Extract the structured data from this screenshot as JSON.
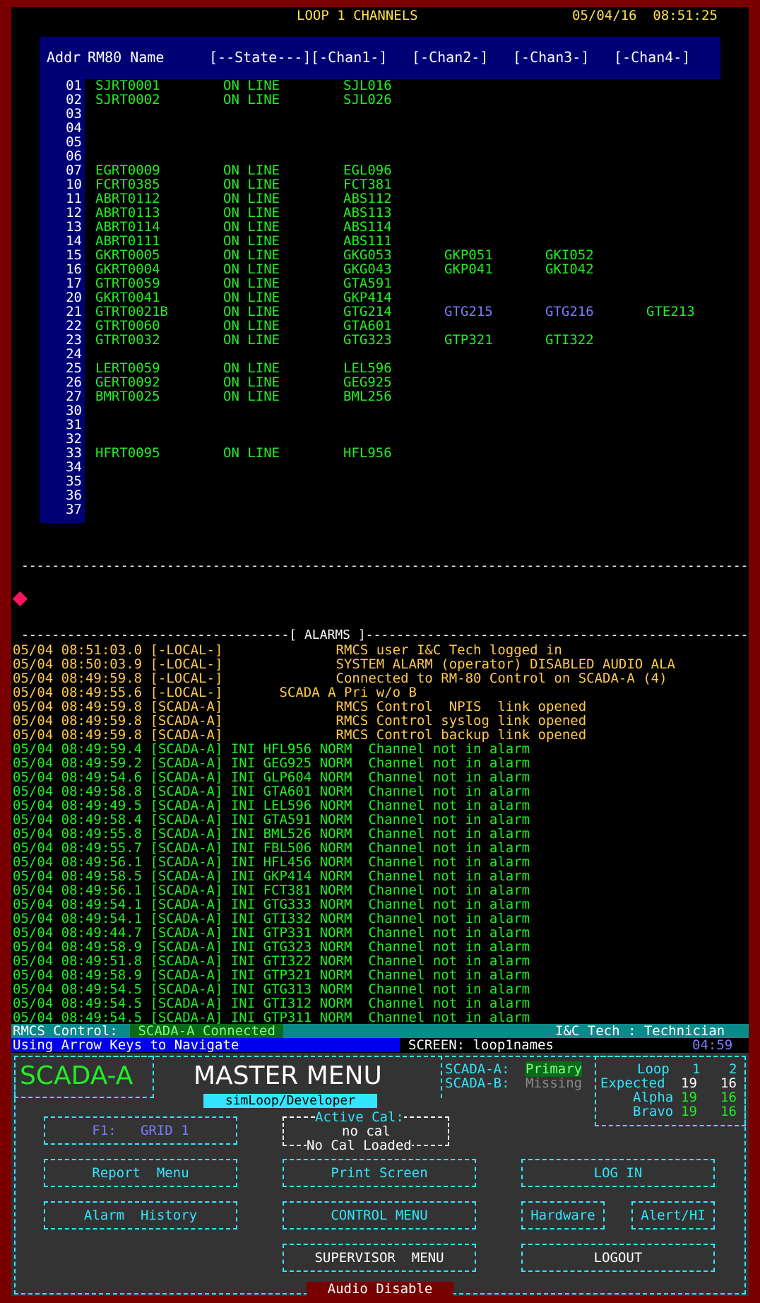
{
  "header": {
    "title": "LOOP 1 CHANNELS",
    "datetime": "05/04/16  08:51:25"
  },
  "table": {
    "headers": [
      "Addr",
      "RM80 Name",
      "[--State---]",
      "[-Chan1-]",
      "[-Chan2-]",
      "[-Chan3-]",
      "[-Chan4-]"
    ],
    "rows": [
      {
        "addr": "01",
        "name": "SJRT0001",
        "state": "ON LINE",
        "c1": "SJL016",
        "c2": "",
        "c3": "",
        "c4": ""
      },
      {
        "addr": "02",
        "name": "SJRT0002",
        "state": "ON LINE",
        "c1": "SJL026",
        "c2": "",
        "c3": "",
        "c4": ""
      },
      {
        "addr": "03",
        "name": "",
        "state": "",
        "c1": "",
        "c2": "",
        "c3": "",
        "c4": ""
      },
      {
        "addr": "04",
        "name": "",
        "state": "",
        "c1": "",
        "c2": "",
        "c3": "",
        "c4": ""
      },
      {
        "addr": "05",
        "name": "",
        "state": "",
        "c1": "",
        "c2": "",
        "c3": "",
        "c4": ""
      },
      {
        "addr": "06",
        "name": "",
        "state": "",
        "c1": "",
        "c2": "",
        "c3": "",
        "c4": ""
      },
      {
        "addr": "07",
        "name": "EGRT0009",
        "state": "ON LINE",
        "c1": "EGL096",
        "c2": "",
        "c3": "",
        "c4": ""
      },
      {
        "addr": "10",
        "name": "FCRT0385",
        "state": "ON LINE",
        "c1": "FCT381",
        "c2": "",
        "c3": "",
        "c4": ""
      },
      {
        "addr": "11",
        "name": "ABRT0112",
        "state": "ON LINE",
        "c1": "ABS112",
        "c2": "",
        "c3": "",
        "c4": ""
      },
      {
        "addr": "12",
        "name": "ABRT0113",
        "state": "ON LINE",
        "c1": "ABS113",
        "c2": "",
        "c3": "",
        "c4": ""
      },
      {
        "addr": "13",
        "name": "ABRT0114",
        "state": "ON LINE",
        "c1": "ABS114",
        "c2": "",
        "c3": "",
        "c4": ""
      },
      {
        "addr": "14",
        "name": "ABRT0111",
        "state": "ON LINE",
        "c1": "ABS111",
        "c2": "",
        "c3": "",
        "c4": ""
      },
      {
        "addr": "15",
        "name": "GKRT0005",
        "state": "ON LINE",
        "c1": "GKG053",
        "c2": "GKP051",
        "c3": "GKI052",
        "c4": ""
      },
      {
        "addr": "16",
        "name": "GKRT0004",
        "state": "ON LINE",
        "c1": "GKG043",
        "c2": "GKP041",
        "c3": "GKI042",
        "c4": ""
      },
      {
        "addr": "17",
        "name": "GTRT0059",
        "state": "ON LINE",
        "c1": "GTA591",
        "c2": "",
        "c3": "",
        "c4": ""
      },
      {
        "addr": "20",
        "name": "GKRT0041",
        "state": "ON LINE",
        "c1": "GKP414",
        "c2": "",
        "c3": "",
        "c4": ""
      },
      {
        "addr": "21",
        "name": "GTRT0021B",
        "state": "ON LINE",
        "c1": "GTG214",
        "c2": "GTG215",
        "c3": "GTG216",
        "c4": "GTE213"
      },
      {
        "addr": "22",
        "name": "GTRT0060",
        "state": "ON LINE",
        "c1": "GTA601",
        "c2": "",
        "c3": "",
        "c4": ""
      },
      {
        "addr": "23",
        "name": "GTRT0032",
        "state": "ON LINE",
        "c1": "GTG323",
        "c2": "GTP321",
        "c3": "GTI322",
        "c4": ""
      },
      {
        "addr": "24",
        "name": "",
        "state": "",
        "c1": "",
        "c2": "",
        "c3": "",
        "c4": ""
      },
      {
        "addr": "25",
        "name": "LERT0059",
        "state": "ON LINE",
        "c1": "LEL596",
        "c2": "",
        "c3": "",
        "c4": ""
      },
      {
        "addr": "26",
        "name": "GERT0092",
        "state": "ON LINE",
        "c1": "GEG925",
        "c2": "",
        "c3": "",
        "c4": ""
      },
      {
        "addr": "27",
        "name": "BMRT0025",
        "state": "ON LINE",
        "c1": "BML256",
        "c2": "",
        "c3": "",
        "c4": ""
      },
      {
        "addr": "30",
        "name": "",
        "state": "",
        "c1": "",
        "c2": "",
        "c3": "",
        "c4": ""
      },
      {
        "addr": "31",
        "name": "",
        "state": "",
        "c1": "",
        "c2": "",
        "c3": "",
        "c4": ""
      },
      {
        "addr": "32",
        "name": "",
        "state": "",
        "c1": "",
        "c2": "",
        "c3": "",
        "c4": ""
      },
      {
        "addr": "33",
        "name": "HFRT0095",
        "state": "ON LINE",
        "c1": "HFL956",
        "c2": "",
        "c3": "",
        "c4": ""
      },
      {
        "addr": "34",
        "name": "",
        "state": "",
        "c1": "",
        "c2": "",
        "c3": "",
        "c4": ""
      },
      {
        "addr": "35",
        "name": "",
        "state": "",
        "c1": "",
        "c2": "",
        "c3": "",
        "c4": ""
      },
      {
        "addr": "36",
        "name": "",
        "state": "",
        "c1": "",
        "c2": "",
        "c3": "",
        "c4": ""
      },
      {
        "addr": "37",
        "name": "",
        "state": "",
        "c1": "",
        "c2": "",
        "c3": "",
        "c4": ""
      }
    ]
  },
  "separator": "------------------------------------------------------------------------------------------------------------------------",
  "alarms": {
    "header": "-----------------------------------[ ALARMS ]-----------------------------------------------------------------------",
    "rows": [
      {
        "text": "05/04 08:51:03.0 [-LOCAL-]              RMCS user I&C Tech logged in",
        "color": "#ffc94a"
      },
      {
        "text": "05/04 08:50:03.9 [-LOCAL-]              SYSTEM ALARM (operator) DISABLED AUDIO ALA",
        "color": "#ffc94a"
      },
      {
        "text": "05/04 08:49:59.8 [-LOCAL-]              Connected to RM-80 Control on SCADA-A (4)",
        "color": "#ffc94a"
      },
      {
        "text": "05/04 08:49:55.6 [-LOCAL-]       SCADA A Pri w/o B",
        "color": "#ffc94a"
      },
      {
        "text": "05/04 08:49:59.8 [SCADA-A]              RMCS Control  NPIS  link opened",
        "color": "#ffc94a"
      },
      {
        "text": "05/04 08:49:59.8 [SCADA-A]              RMCS Control syslog link opened",
        "color": "#ffc94a"
      },
      {
        "text": "05/04 08:49:59.8 [SCADA-A]              RMCS Control backup link opened",
        "color": "#ffc94a"
      },
      {
        "text": "05/04 08:49:59.4 [SCADA-A] INI HFL956 NORM  Channel not in alarm",
        "color": "#22ee22"
      },
      {
        "text": "05/04 08:49:59.2 [SCADA-A] INI GEG925 NORM  Channel not in alarm",
        "color": "#22ee22"
      },
      {
        "text": "05/04 08:49:54.6 [SCADA-A] INI GLP604 NORM  Channel not in alarm",
        "color": "#22ee22"
      },
      {
        "text": "05/04 08:49:58.8 [SCADA-A] INI GTA601 NORM  Channel not in alarm",
        "color": "#22ee22"
      },
      {
        "text": "05/04 08:49:49.5 [SCADA-A] INI LEL596 NORM  Channel not in alarm",
        "color": "#22ee22"
      },
      {
        "text": "05/04 08:49:58.4 [SCADA-A] INI GTA591 NORM  Channel not in alarm",
        "color": "#22ee22"
      },
      {
        "text": "05/04 08:49:55.8 [SCADA-A] INI BML526 NORM  Channel not in alarm",
        "color": "#22ee22"
      },
      {
        "text": "05/04 08:49:55.7 [SCADA-A] INI FBL506 NORM  Channel not in alarm",
        "color": "#22ee22"
      },
      {
        "text": "05/04 08:49:56.1 [SCADA-A] INI HFL456 NORM  Channel not in alarm",
        "color": "#22ee22"
      },
      {
        "text": "05/04 08:49:58.5 [SCADA-A] INI GKP414 NORM  Channel not in alarm",
        "color": "#22ee22"
      },
      {
        "text": "05/04 08:49:56.1 [SCADA-A] INI FCT381 NORM  Channel not in alarm",
        "color": "#22ee22"
      },
      {
        "text": "05/04 08:49:54.1 [SCADA-A] INI GTG333 NORM  Channel not in alarm",
        "color": "#22ee22"
      },
      {
        "text": "05/04 08:49:54.1 [SCADA-A] INI GTI332 NORM  Channel not in alarm",
        "color": "#22ee22"
      },
      {
        "text": "05/04 08:49:44.7 [SCADA-A] INI GTP331 NORM  Channel not in alarm",
        "color": "#22ee22"
      },
      {
        "text": "05/04 08:49:58.9 [SCADA-A] INI GTG323 NORM  Channel not in alarm",
        "color": "#22ee22"
      },
      {
        "text": "05/04 08:49:51.8 [SCADA-A] INI GTI322 NORM  Channel not in alarm",
        "color": "#22ee22"
      },
      {
        "text": "05/04 08:49:58.9 [SCADA-A] INI GTP321 NORM  Channel not in alarm",
        "color": "#22ee22"
      },
      {
        "text": "05/04 08:49:54.5 [SCADA-A] INI GTG313 NORM  Channel not in alarm",
        "color": "#22ee22"
      },
      {
        "text": "05/04 08:49:54.5 [SCADA-A] INI GTI312 NORM  Channel not in alarm",
        "color": "#22ee22"
      },
      {
        "text": "05/04 08:49:54.5 [SCADA-A] INI GTP311 NORM  Channel not in alarm",
        "color": "#22ee22"
      }
    ]
  },
  "status": {
    "rmcs_label": "RMCS Control:",
    "rmcs_value": " SCADA-A Connected ",
    "user": "I&C Tech : Technician",
    "nav_hint": "Using Arrow Keys to Navigate",
    "screen": "SCREEN: loop1names",
    "timer": "04:59"
  },
  "menu": {
    "system": "SCADA-A",
    "title": "MASTER MENU",
    "subtitle": "simLoop/Developer",
    "scada_a_label": "SCADA-A:",
    "scada_a_value": "Primary",
    "scada_b_label": "SCADA-B:",
    "scada_b_value": "Missing",
    "loops": {
      "label": "Loop",
      "l1": "1",
      "l2": "2",
      "expected_label": "Expected",
      "expected1": "19",
      "expected2": "16",
      "alpha_label": "Alpha",
      "alpha1": "19",
      "alpha2": "16",
      "bravo_label": "Bravo",
      "bravo1": "19",
      "bravo2": "16"
    },
    "active_cal_label": "Active Cal:",
    "active_cal_value": "no cal",
    "no_cal_loaded": "No Cal Loaded",
    "buttons": {
      "f1": "F1:   GRID 1",
      "report": "Report  Menu",
      "print": "Print Screen",
      "login": "LOG IN",
      "alarm_history": "Alarm  History",
      "control": "CONTROL MENU",
      "hardware": "Hardware",
      "alert": "Alert/HI",
      "supervisor": "SUPERVISOR  MENU",
      "logout": "LOGOUT"
    },
    "audio": "Audio Disable"
  },
  "colors": {
    "frame": "#7a0000",
    "table_bg": "#000075",
    "green": "#22ee22",
    "blue_channel": "#7b7bff",
    "orange": "#ffc94a",
    "cyan": "#33e5ff",
    "panel": "#333333"
  }
}
